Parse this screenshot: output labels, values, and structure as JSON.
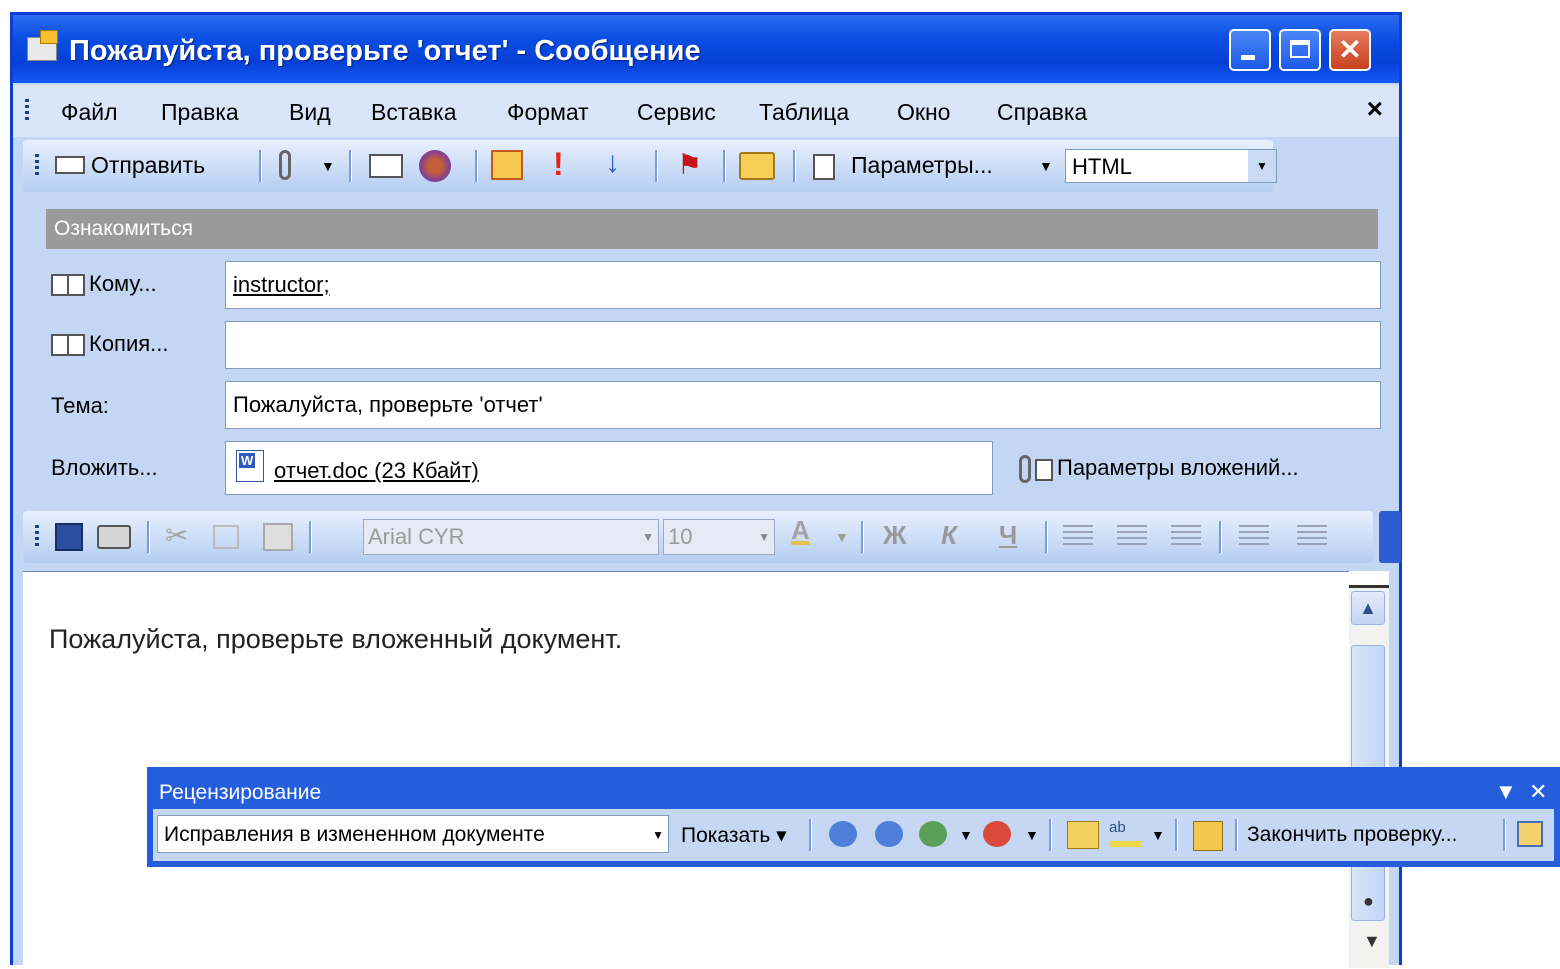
{
  "window": {
    "title": "Пожалуйста, проверьте 'отчет' - Сообщение"
  },
  "menu": {
    "items": [
      "Файл",
      "Правка",
      "Вид",
      "Вставка",
      "Формат",
      "Сервис",
      "Таблица",
      "Окно",
      "Справка"
    ],
    "close": "×"
  },
  "toolbar": {
    "send_label": "Отправить",
    "options_label": "Параметры...",
    "format_value": "HTML"
  },
  "infobar": {
    "text": "Ознакомиться"
  },
  "fields": {
    "to_label": "Кому...",
    "to_value": "instructor;",
    "cc_label": "Копия...",
    "cc_value": "",
    "subject_label": "Тема:",
    "subject_value": "Пожалуйста, проверьте 'отчет'",
    "attach_label": "Вложить...",
    "attachment": "отчет.doc (23 Кбайт)",
    "attach_options": "Параметры вложений..."
  },
  "format_toolbar": {
    "font": "Arial CYR",
    "size": "10",
    "bold": "Ж",
    "italic": "К",
    "underline": "Ч",
    "font_color": "A"
  },
  "body": {
    "text": "Пожалуйста, проверьте вложенный документ."
  },
  "review_toolbar": {
    "title": "Рецензирование",
    "display_value": "Исправления в измененном документе",
    "show_label": "Показать",
    "finish_label": "Закончить проверку..."
  },
  "colors": {
    "titlebar": "#0b4ee3",
    "toolbar_bg": "#c3d6f4",
    "review_title_bg": "#245edc",
    "infobar_bg": "#9a9a9a"
  }
}
